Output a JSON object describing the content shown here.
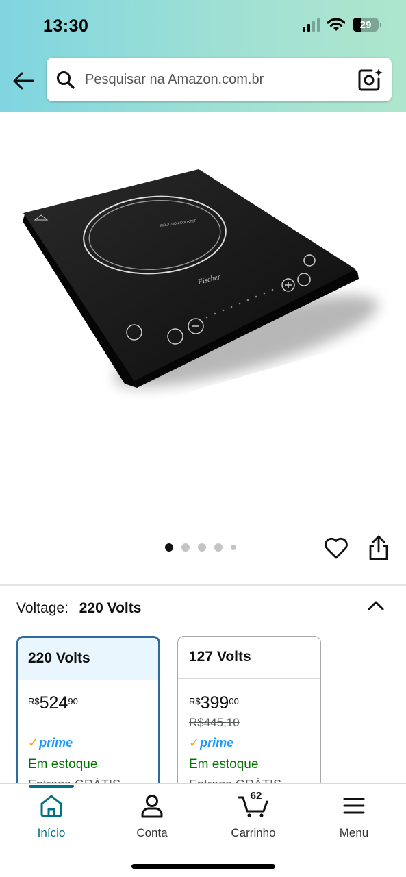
{
  "status_bar": {
    "time": "13:30",
    "battery": "29"
  },
  "search": {
    "placeholder": "Pesquisar na Amazon.com.br"
  },
  "product_image": {
    "brand_mark": "Fischer",
    "alt_subject": "induction-cooktop"
  },
  "carousel": {
    "count": 5,
    "active_index": 0
  },
  "selector": {
    "label": "Voltage:",
    "value": "220 Volts"
  },
  "options": [
    {
      "title": "220 Volts",
      "price_symbol": "R$",
      "price_whole": "524",
      "price_fraction": "90",
      "old_price": "",
      "prime": "prime",
      "stock": "Em estoque",
      "delivery": "Entrega GRÁTIS",
      "selected": true
    },
    {
      "title": "127 Volts",
      "price_symbol": "R$",
      "price_whole": "399",
      "price_fraction": "00",
      "old_price": "R$445,10",
      "prime": "prime",
      "stock": "Em estoque",
      "delivery": "Entrega GRÁTIS",
      "selected": false
    }
  ],
  "nav": {
    "home": "Início",
    "account": "Conta",
    "cart": "Carrinho",
    "cart_count": "62",
    "menu": "Menu"
  },
  "colors": {
    "header_gradient_start": "#7fd5e0",
    "header_gradient_end": "#aee6cd",
    "selected_border": "#2e6a9e",
    "in_stock": "#007600",
    "prime_blue": "#1a98ff",
    "active_nav": "#007185"
  }
}
